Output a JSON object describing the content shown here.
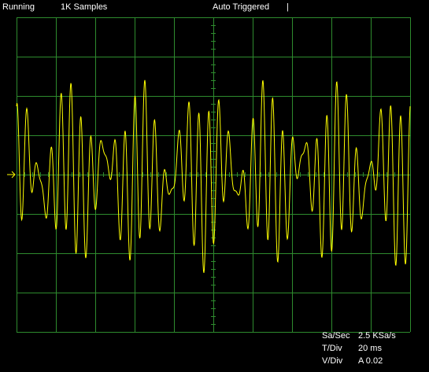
{
  "status": {
    "run_state": "Running",
    "samples": "1K Samples",
    "trigger_mode": "Auto Triggered",
    "marker": "|"
  },
  "readouts": {
    "sample_rate_label": "Sa/Sec",
    "sample_rate_value": "2.5 KSa/s",
    "time_div_label": "T/Div",
    "time_div_value": "20 ms",
    "volt_div_label": "V/Div",
    "volt_div_value": "A 0.02"
  },
  "colors": {
    "background": "#000000",
    "grid": "#2e8b2e",
    "trace": "#ffff00",
    "text": "#ffffff"
  },
  "icons": {
    "channel_marker": "channel-a-ground-arrow-icon"
  },
  "chart_data": {
    "type": "line",
    "title": "",
    "xlabel": "",
    "ylabel": "",
    "divisions": {
      "x": 10,
      "y": 8
    },
    "time_per_div_ms": 20,
    "volts_per_div": 0.02,
    "xlim_ms": [
      0,
      200
    ],
    "ylim_v": [
      -0.08,
      0.08
    ],
    "series": [
      {
        "components": [
          {
            "freq_hz": 50,
            "amp_v": 0.01
          },
          {
            "freq_hz": 185,
            "amp_v": 0.022
          },
          {
            "freq_hz": 215,
            "amp_v": 0.018
          }
        ],
        "peak_v": 0.05
      }
    ]
  }
}
